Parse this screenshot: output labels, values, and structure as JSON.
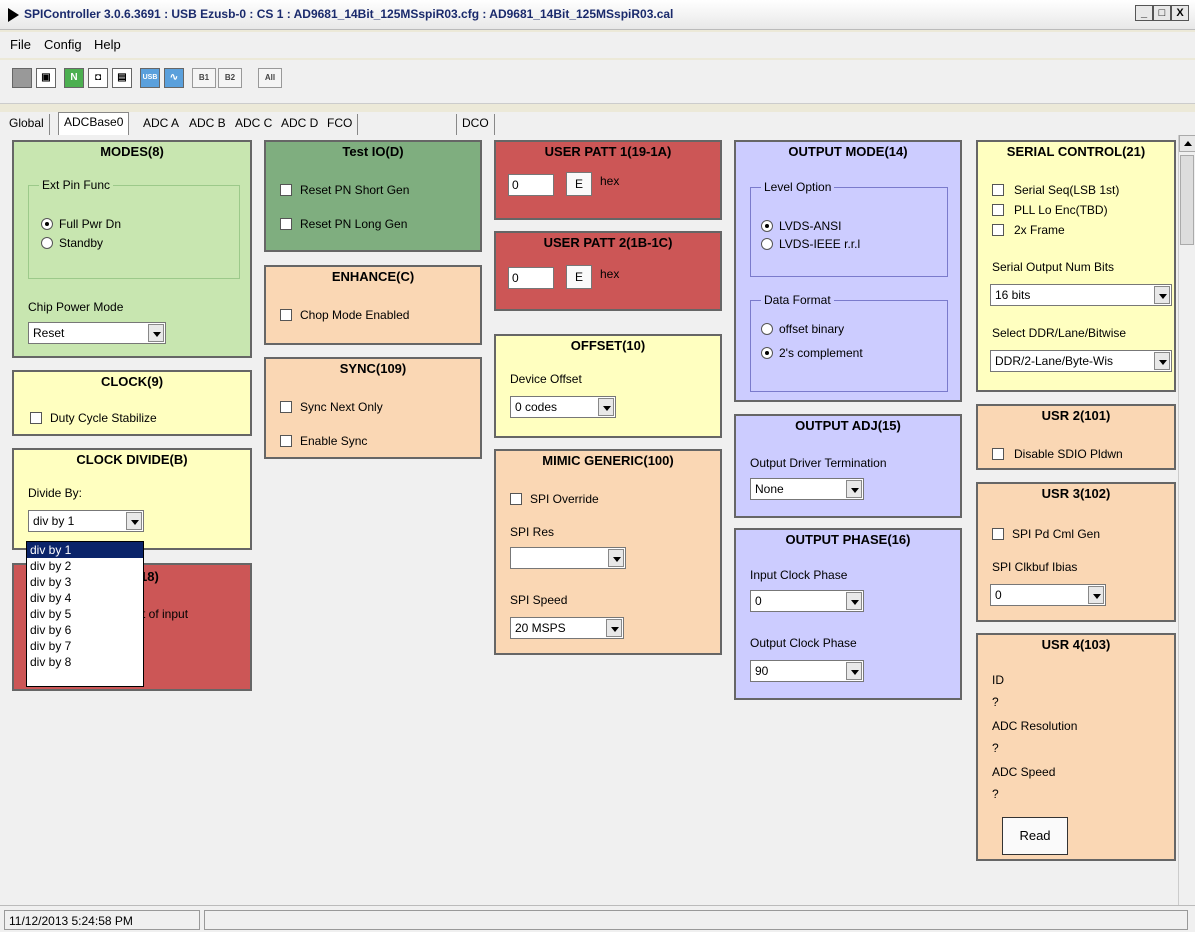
{
  "window": {
    "title": "SPIController 3.0.6.3691 : USB Ezusb-0 : CS 1 : AD9681_14Bit_125MSspiR03.cfg : AD9681_14Bit_125MSspiR03.cal",
    "minimize": "_",
    "maximize": "□",
    "close": "X"
  },
  "menu": [
    "File",
    "Config",
    "Help"
  ],
  "toolbar": {
    "n_label": "N",
    "b1": "B1",
    "b2": "B2",
    "all": "All",
    "usb": "USB"
  },
  "tabs": [
    "Global",
    "ADCBase0",
    "ADC A",
    "ADC B",
    "ADC C",
    "ADC D",
    "FCO",
    "DCO"
  ],
  "active_tab": "ADCBase0",
  "modes": {
    "title": "MODES(8)",
    "group": "Ext Pin Func",
    "radio1": "Full Pwr Dn",
    "radio2": "Standby",
    "chip_label": "Chip Power Mode",
    "chip_value": "Reset"
  },
  "clock": {
    "title": "CLOCK(9)",
    "dcs": "Duty Cycle Stabilize"
  },
  "clock_divide": {
    "title": "CLOCK DIVIDE(B)",
    "label": "Divide By:",
    "value": "div by 1",
    "options": [
      "div by 1",
      "div by 2",
      "div by 3",
      "div by 4",
      "div by 5",
      "div by 6",
      "div by 7",
      "div by 8"
    ]
  },
  "hidden_panel": {
    "title_fragment": "18)",
    "text_fragment": "t of input"
  },
  "testio": {
    "title": "Test IO(D)",
    "cb1": "Reset PN Short Gen",
    "cb2": "Reset PN Long Gen"
  },
  "enhance": {
    "title": "ENHANCE(C)",
    "cb1": "Chop Mode Enabled"
  },
  "sync": {
    "title": "SYNC(109)",
    "cb1": "Sync Next Only",
    "cb2": "Enable Sync"
  },
  "user_patt1": {
    "title": "USER PATT 1(19-1A)",
    "value": "0",
    "btn": "E",
    "unit": "hex"
  },
  "user_patt2": {
    "title": "USER PATT 2(1B-1C)",
    "value": "0",
    "btn": "E",
    "unit": "hex"
  },
  "offset": {
    "title": "OFFSET(10)",
    "label": "Device Offset",
    "value": "0 codes"
  },
  "mimic": {
    "title": "MIMIC GENERIC(100)",
    "cb1": "SPI Override",
    "res_label": "SPI Res",
    "res_value": "",
    "speed_label": "SPI Speed",
    "speed_value": "20 MSPS"
  },
  "output_mode": {
    "title": "OUTPUT MODE(14)",
    "group1": "Level Option",
    "r1": "LVDS-ANSI",
    "r2": "LVDS-IEEE r.r.l",
    "group2": "Data Format",
    "r3": "offset binary",
    "r4": "2's complement"
  },
  "output_adj": {
    "title": "OUTPUT ADJ(15)",
    "label": "Output Driver Termination",
    "value": "None"
  },
  "output_phase": {
    "title": "OUTPUT PHASE(16)",
    "in_label": "Input Clock Phase",
    "in_value": "0",
    "out_label": "Output Clock Phase",
    "out_value": "90"
  },
  "serial": {
    "title": "SERIAL CONTROL(21)",
    "cb1": "Serial Seq(LSB 1st)",
    "cb2": "PLL Lo Enc(TBD)",
    "cb3": "2x Frame",
    "bits_label": "Serial Output Num Bits",
    "bits_value": "16 bits",
    "ddr_label": "Select DDR/Lane/Bitwise",
    "ddr_value": "DDR/2-Lane/Byte-Wis"
  },
  "usr2": {
    "title": "USR 2(101)",
    "cb1": "Disable SDIO Pldwn"
  },
  "usr3": {
    "title": "USR 3(102)",
    "cb1": "SPI Pd Cml Gen",
    "label": "SPI Clkbuf Ibias",
    "value": "0"
  },
  "usr4": {
    "title": "USR 4(103)",
    "id_label": "ID",
    "id_value": "?",
    "res_label": "ADC Resolution",
    "res_value": "?",
    "speed_label": "ADC Speed",
    "speed_value": "?",
    "read": "Read"
  },
  "status": {
    "time": "11/12/2013 5:24:58 PM"
  }
}
